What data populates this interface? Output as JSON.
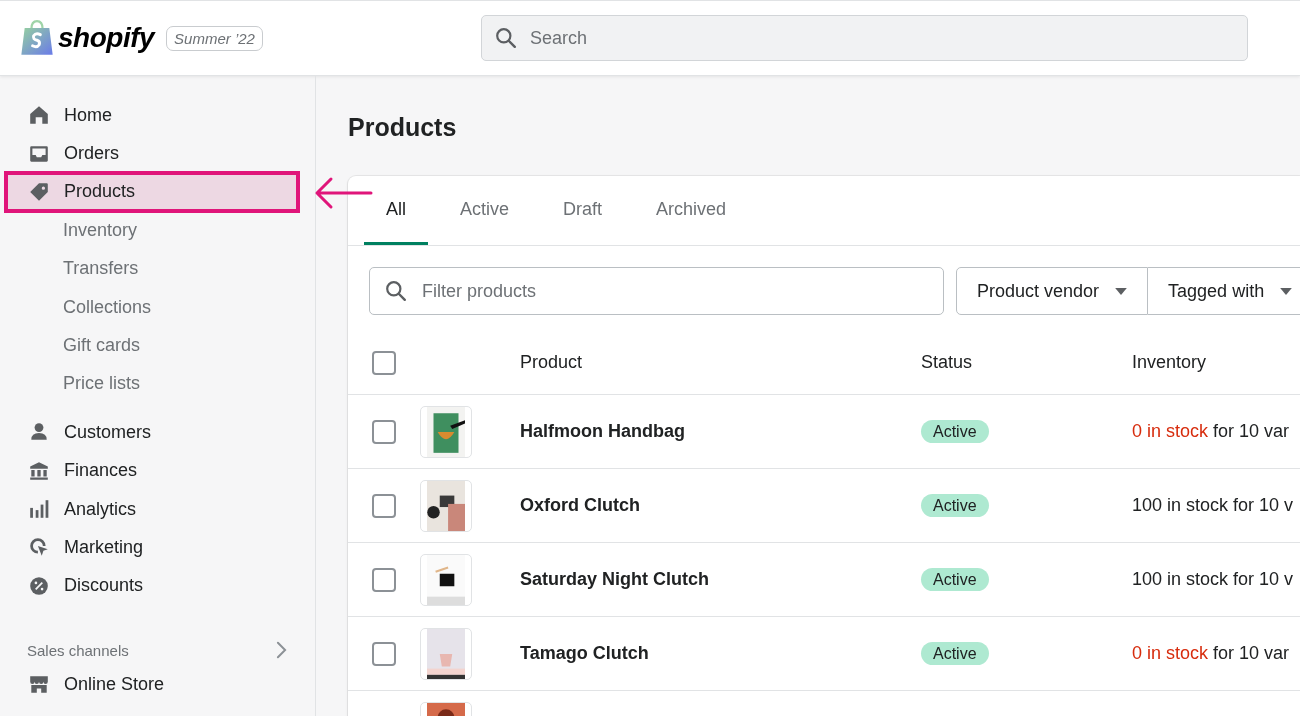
{
  "topbar": {
    "brand": "shopify",
    "edition": "Summer ’22",
    "search": {
      "placeholder": "Search"
    }
  },
  "sidebar": {
    "items": [
      {
        "label": "Home",
        "sub": false,
        "selected": false,
        "highlighted": false
      },
      {
        "label": "Orders",
        "sub": false,
        "selected": false,
        "highlighted": false
      },
      {
        "label": "Products",
        "sub": false,
        "selected": true,
        "highlighted": true
      },
      {
        "label": "Inventory",
        "sub": true,
        "selected": false,
        "highlighted": false
      },
      {
        "label": "Transfers",
        "sub": true,
        "selected": false,
        "highlighted": false
      },
      {
        "label": "Collections",
        "sub": true,
        "selected": false,
        "highlighted": false
      },
      {
        "label": "Gift cards",
        "sub": true,
        "selected": false,
        "highlighted": false
      },
      {
        "label": "Price lists",
        "sub": true,
        "selected": false,
        "highlighted": false
      },
      {
        "label": "Customers",
        "sub": false,
        "selected": false,
        "highlighted": false
      },
      {
        "label": "Finances",
        "sub": false,
        "selected": false,
        "highlighted": false
      },
      {
        "label": "Analytics",
        "sub": false,
        "selected": false,
        "highlighted": false
      },
      {
        "label": "Marketing",
        "sub": false,
        "selected": false,
        "highlighted": false
      },
      {
        "label": "Discounts",
        "sub": false,
        "selected": false,
        "highlighted": false
      }
    ],
    "section": {
      "title": "Sales channels",
      "items": [
        {
          "label": "Online Store",
          "selected": false
        }
      ]
    }
  },
  "page": {
    "title": "Products",
    "tabs": [
      {
        "label": "All",
        "selected": true
      },
      {
        "label": "Active",
        "selected": false
      },
      {
        "label": "Draft",
        "selected": false
      },
      {
        "label": "Archived",
        "selected": false
      }
    ],
    "filter": {
      "placeholder": "Filter products"
    },
    "filter_buttons": [
      "Product vendor",
      "Tagged with"
    ],
    "table": {
      "select_all": {
        "checked": false
      },
      "columns": [
        "Product",
        "Status",
        "Inventory"
      ],
      "rows": [
        {
          "checked": false,
          "thumbnail": {
            "kind": "picture"
          },
          "name": "Halfmoon Handbag",
          "status": "Active",
          "stock": "0 in stock",
          "stock_low": true,
          "inventory_rest": "for 10 var"
        },
        {
          "checked": false,
          "thumbnail": {
            "kind": "picture"
          },
          "name": "Oxford Clutch",
          "status": "Active",
          "stock": "100 in stock",
          "stock_low": false,
          "inventory_rest": "for 10 v"
        },
        {
          "checked": false,
          "thumbnail": {
            "kind": "picture"
          },
          "name": "Saturday Night Clutch",
          "status": "Active",
          "stock": "100 in stock",
          "stock_low": false,
          "inventory_rest": "for 10 v"
        },
        {
          "checked": false,
          "thumbnail": {
            "kind": "picture"
          },
          "name": "Tamago Clutch",
          "status": "Active",
          "stock": "0 in stock",
          "stock_low": true,
          "inventory_rest": "for 10 var"
        }
      ],
      "clipped_row": {
        "thumbnail": {
          "kind": "picture"
        }
      }
    }
  }
}
